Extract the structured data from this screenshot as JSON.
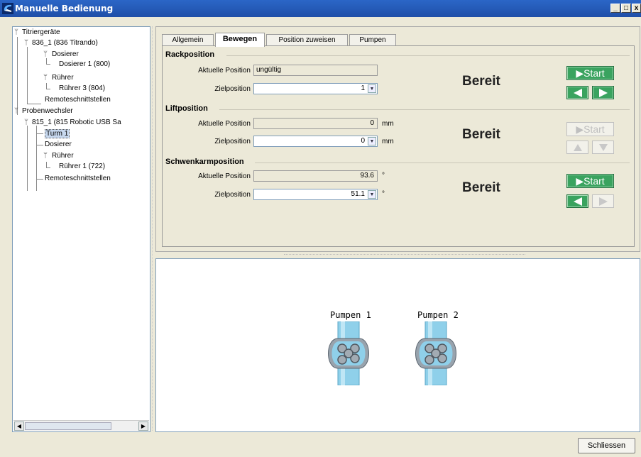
{
  "window": {
    "title": "Manuelle Bedienung",
    "controls": [
      "_",
      "□",
      "x"
    ]
  },
  "tree": {
    "nodes": [
      {
        "label": "Titriergeräte"
      },
      {
        "label": "836_1 (836 Titrando)"
      },
      {
        "label": "Dosierer"
      },
      {
        "label": "Dosierer 1 (800)"
      },
      {
        "label": "Rührer"
      },
      {
        "label": "Rührer 3 (804)"
      },
      {
        "label": "Remoteschnittstellen"
      },
      {
        "label": "Probenwechsler"
      },
      {
        "label": "815_1 (815 Robotic USB Sa"
      },
      {
        "label": "Turm 1"
      },
      {
        "label": "Dosierer"
      },
      {
        "label": "Rührer"
      },
      {
        "label": "Rührer 1 (722)"
      },
      {
        "label": "Remoteschnittstellen"
      }
    ],
    "scroll": {
      "left": "◀",
      "right": "▶"
    }
  },
  "tabs": [
    {
      "label": "Allgemein"
    },
    {
      "label": "Bewegen",
      "active": true
    },
    {
      "label": "Position zuweisen"
    },
    {
      "label": "Pumpen"
    }
  ],
  "sections": {
    "rack": {
      "title": "Rackposition",
      "current_label": "Aktuelle Position",
      "current_value": "ungültig",
      "target_label": "Zielposition",
      "target_value": "1",
      "status": "Bereit",
      "start_label": "▶Start",
      "start_enabled": true
    },
    "lift": {
      "title": "Liftposition",
      "current_label": "Aktuelle Position",
      "current_value": "0",
      "current_unit": "mm",
      "target_label": "Zielposition",
      "target_value": "0",
      "target_unit": "mm",
      "status": "Bereit",
      "start_label": "▶Start",
      "start_enabled": false
    },
    "swing": {
      "title": "Schwenkarmposition",
      "current_label": "Aktuelle Position",
      "current_value": "93.6",
      "current_unit": "°",
      "target_label": "Zielposition",
      "target_value": "51.1",
      "target_unit": "°",
      "status": "Bereit",
      "start_label": "▶Start",
      "start_enabled": true
    }
  },
  "pumps": [
    {
      "label": "Pumpen 1"
    },
    {
      "label": "Pumpen 2"
    }
  ],
  "footer": {
    "close_label": "Schliessen"
  },
  "colors": {
    "titlebar": "#1f4fa8",
    "start_green": "#3aa35f",
    "pump_tube": "#7dc3e0",
    "pump_body": "#8f9aa4"
  }
}
